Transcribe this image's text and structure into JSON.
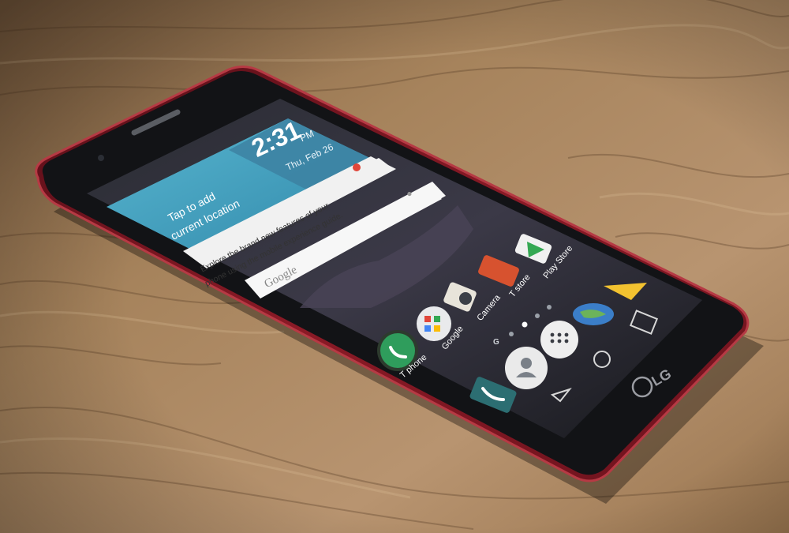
{
  "scene": {
    "brand_logo": "LG",
    "colors": {
      "wood_light": "#b08a62",
      "wood_dark": "#6b4d32",
      "phone_body": "#7a1420",
      "phone_rim": "#a82c36",
      "screen_bg": "#1b1d22",
      "weather_sky": "#4fa6c8",
      "weather_sea": "#3a8fb0",
      "card_bg": "#f3f3f3",
      "accent_red": "#e0463a"
    }
  },
  "status_bar": {
    "icons": [
      "camera-icon",
      "wifi-icon",
      "battery-icon"
    ]
  },
  "clock_widget": {
    "time": "2:31",
    "ampm": "PM",
    "date": "Thu, Feb 26",
    "location_prompt_line1": "Tap to add",
    "location_prompt_line2": "current location"
  },
  "notice_card": {
    "text_line1": "Explore the brand new features of your",
    "text_line2": "phone using the mobile experience guide."
  },
  "search_bar": {
    "label": "Google",
    "mic_icon": "mic-icon"
  },
  "apps_row1": [
    {
      "label": "Camera",
      "icon": "camera-app-icon"
    },
    {
      "label": "T store",
      "icon": "tstore-app-icon"
    },
    {
      "label": "Play Store",
      "icon": "playstore-app-icon"
    }
  ],
  "apps_row2": [
    {
      "label": "Google",
      "icon": "google-folder-icon"
    },
    {
      "label": "",
      "icon": "earth-app-icon"
    }
  ],
  "page_indicator": {
    "letter": "G",
    "dots": 4,
    "active_index": 1
  },
  "dock": [
    {
      "label": "T phone",
      "icon": "phone-app-icon"
    },
    {
      "label": "",
      "icon": "app-drawer-icon"
    },
    {
      "label": "",
      "icon": "contacts-icon"
    },
    {
      "label": "",
      "icon": "messages-icon"
    },
    {
      "label": "",
      "icon": "folder-app-icon"
    }
  ],
  "nav_bar": {
    "buttons": [
      "recent-apps-button",
      "home-button",
      "back-button"
    ]
  }
}
